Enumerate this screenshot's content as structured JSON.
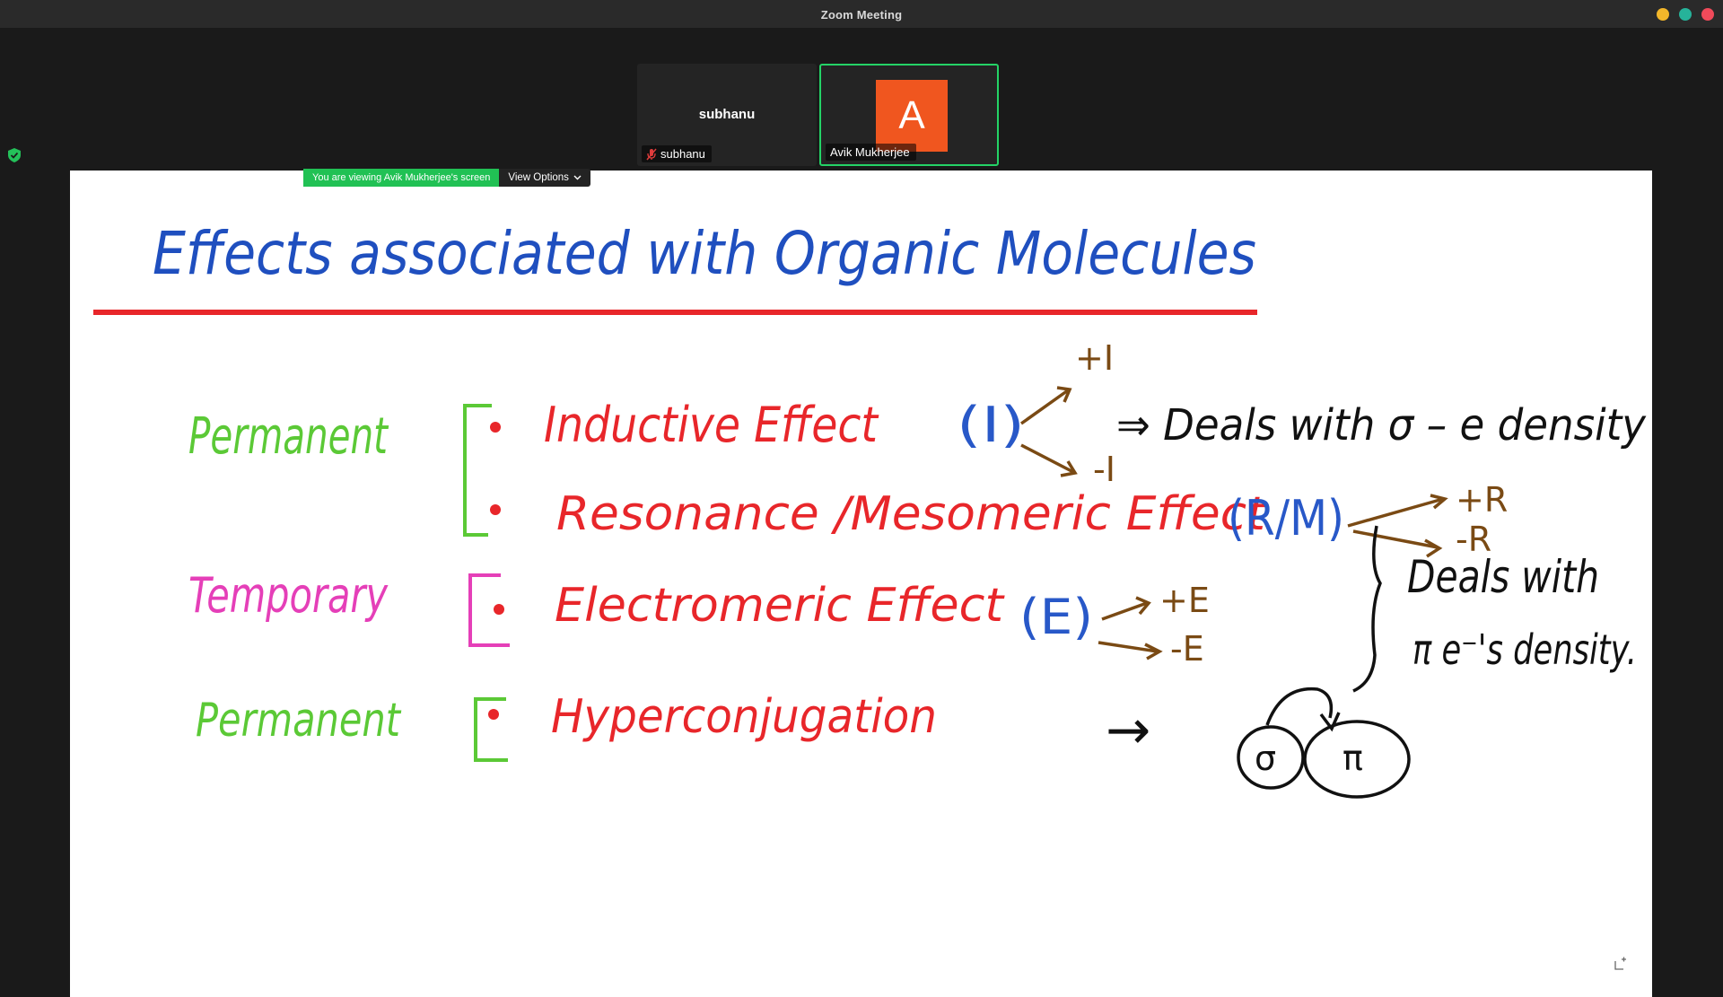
{
  "window": {
    "title": "Zoom Meeting"
  },
  "participants": [
    {
      "display_name": "subhanu",
      "tag_name": "subhanu",
      "muted": true
    },
    {
      "avatar_letter": "A",
      "tag_name": "Avik Mukherjee",
      "active_speaker": true
    }
  ],
  "share": {
    "viewing_text": "You are viewing Avik Mukherjee's screen",
    "view_options_label": "View Options"
  },
  "whiteboard": {
    "title": "Effects associated with Organic Molecules",
    "rows": [
      {
        "category": "Permanent",
        "effect": "Inductive Effect",
        "symbol": "(I)",
        "plus": "+I",
        "minus": "-I"
      },
      {
        "effect": "Resonance /Mesomeric Effect",
        "symbol": "(R/M)",
        "plus": "+R",
        "minus": "-R"
      },
      {
        "category": "Temporary",
        "effect": "Electromeric Effect",
        "symbol": "(E)",
        "plus": "+E",
        "minus": "-E"
      },
      {
        "category": "Permanent",
        "effect": "Hyperconjugation"
      }
    ],
    "note_sigma": "⇒ Deals with σ – e density",
    "note_pi_1": "Deals with",
    "note_pi_2": "π e⁻'s density.",
    "orbital_sigma": "σ",
    "orbital_pi": "π",
    "arrow": "→"
  },
  "colors": {
    "title_blue": "#1f4fbf",
    "underline_red": "#e8262a",
    "effect_red": "#e8262a",
    "permanent_green": "#5bc936",
    "temporary_pink": "#e53fb8",
    "bracket_green": "#5bc936",
    "symbol_blue": "#2858c8",
    "sign_brown": "#7a4a14",
    "note_black": "#111111",
    "active_border": "#24d366",
    "share_green": "#21c154",
    "avatar_orange": "#f0561f"
  }
}
